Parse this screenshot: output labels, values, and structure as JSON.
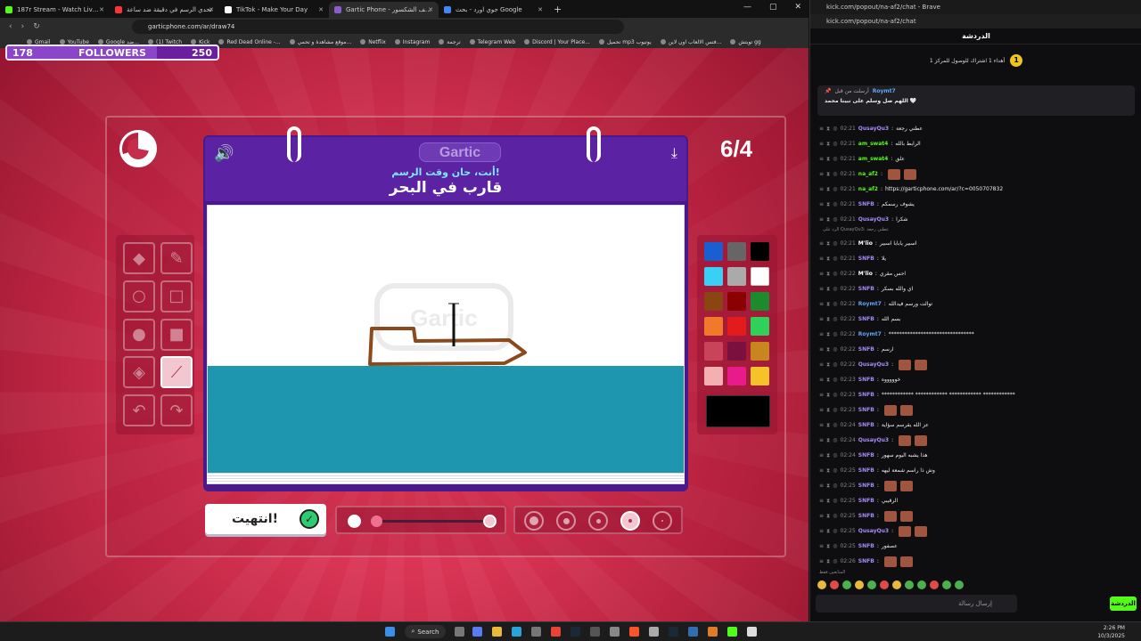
{
  "tabs": [
    {
      "title": "187r Stream - Watch Live on Kick",
      "color": "#53fc18"
    },
    {
      "title": "تحدي الرسم في دقيقة ضد ساعة",
      "color": "#ff3333"
    },
    {
      "title": "TikTok - Make Your Day",
      "color": "#ffffff"
    },
    {
      "title": "Gartic Phone - لعبة الهاتف الشكسور",
      "color": "#8a5ccc",
      "active": true
    },
    {
      "title": "جوي اورد - بحث Google",
      "color": "#4285f4"
    }
  ],
  "address_url": "garticphone.com/ar/draw74",
  "bookmarks": [
    "Gmail",
    "YouTube",
    "Google ضد...",
    "(1) Twitch",
    "Kick",
    "Red Dead Online -...",
    "موقع مشاهدة و تحمي...",
    "Netflix",
    "Instagram",
    "ترجمة",
    "Telegram Web",
    "Discord | Your Place...",
    "تحميل mp3 يوتيوب",
    "فتس الالعاب اون لاين...",
    "تويتش gg"
  ],
  "followers": {
    "label": "FOLLOWERS",
    "current": "178",
    "goal": "250",
    "progress": 0.712
  },
  "game": {
    "counter": "6/4",
    "logo": "Gartic",
    "subtitle": "أنت، حان وقت الرسم!",
    "prompt": "قارب في البحر",
    "done_label": "انتهيت!",
    "watermark": "Gartic",
    "tools": [
      {
        "name": "eraser-tool",
        "icon": "◆"
      },
      {
        "name": "pencil-tool",
        "icon": "✎"
      },
      {
        "name": "ellipse-outline-tool",
        "icon": "○"
      },
      {
        "name": "rect-outline-tool",
        "icon": "□"
      },
      {
        "name": "ellipse-fill-tool",
        "icon": "●"
      },
      {
        "name": "rect-fill-tool",
        "icon": "■"
      },
      {
        "name": "bucket-tool",
        "icon": "◈"
      },
      {
        "name": "line-tool",
        "icon": "⟋",
        "selected": true
      },
      {
        "name": "undo-tool",
        "icon": "↶"
      },
      {
        "name": "redo-tool",
        "icon": "↷"
      }
    ],
    "palette": [
      "#1a5fd1",
      "#666666",
      "#000000",
      "#3ad0f5",
      "#aaaaaa",
      "#ffffff",
      "#8b4513",
      "#8b0000",
      "#1e8a2e",
      "#f07a2a",
      "#e41b1b",
      "#2fd158",
      "#c9445a",
      "#7a1040",
      "#c8861e",
      "#f4b0b0",
      "#e81a8c",
      "#f5c22a"
    ],
    "current_color": "#000000",
    "brush_sizes": 5,
    "selected_size": 4
  },
  "chat": {
    "window_title": "kick.com/popout/na-af2/chat - Brave",
    "url": "kick.com/popout/na-af2/chat",
    "header": "الدردشة",
    "subgoal": "أهداء 1 اشتراك للوصول للمركز 1",
    "subgoal_badge": "1",
    "pinned_by": "أرسلت من قبل",
    "pinned_user": "Roymt7",
    "pinned_text": "اللهم صل وسلم على نبينا محمد 🤍",
    "messages": [
      {
        "time": "02:21",
        "user": "QusayQu3",
        "color": "#a78bfa",
        "text": "عطني رجعة"
      },
      {
        "time": "02:21",
        "user": "am_swat4",
        "color": "#53fc18",
        "text": "الرابط بالله"
      },
      {
        "time": "02:21",
        "user": "am_swat4",
        "color": "#53fc18",
        "text": "علق"
      },
      {
        "time": "02:21",
        "user": "na_af2",
        "color": "#53fc18",
        "text": ""
      },
      {
        "time": "02:21",
        "user": "na_af2",
        "color": "#53fc18",
        "text": "https://garticphone.com/ar/?c=0050707832"
      },
      {
        "time": "02:21",
        "user": "SNFB",
        "color": "#a78bfa",
        "text": "يشوف رسمكم"
      },
      {
        "time": "02:21",
        "user": "QusayQu3",
        "color": "#a78bfa",
        "text": "شكرا"
      },
      {
        "time": "02:21",
        "user": "M'lio",
        "color": "#ffffff",
        "text": "اسبير يابابا اسبير"
      },
      {
        "time": "02:21",
        "user": "SNFB",
        "color": "#a78bfa",
        "text": "يلا"
      },
      {
        "time": "02:22",
        "user": "M'lio",
        "color": "#ffffff",
        "text": "احس مقري"
      },
      {
        "time": "02:22",
        "user": "SNFB",
        "color": "#a78bfa",
        "text": "اي والله بسكر"
      },
      {
        "time": "02:22",
        "user": "Roymt7",
        "color": "#60a5fa",
        "text": "توالت ورسم فيدالله"
      },
      {
        "time": "02:22",
        "user": "SNFB",
        "color": "#a78bfa",
        "text": "بسم الله"
      },
      {
        "time": "02:22",
        "user": "Roymt7",
        "color": "#60a5fa",
        "text": "********************************"
      },
      {
        "time": "02:22",
        "user": "SNFB",
        "color": "#a78bfa",
        "text": "ارسم"
      },
      {
        "time": "02:22",
        "user": "QusayQu3",
        "color": "#a78bfa",
        "text": ""
      },
      {
        "time": "02:23",
        "user": "SNFB",
        "color": "#a78bfa",
        "text": "خوووووه"
      },
      {
        "time": "02:23",
        "user": "SNFB",
        "color": "#a78bfa",
        "text": "************ ************ ************ ************"
      },
      {
        "time": "02:23",
        "user": "SNFB",
        "color": "#a78bfa",
        "text": ""
      },
      {
        "time": "02:24",
        "user": "SNFB",
        "color": "#a78bfa",
        "text": "عز الله يقرسم سؤاية"
      },
      {
        "time": "02:24",
        "user": "QusayQu3",
        "color": "#a78bfa",
        "text": ""
      },
      {
        "time": "02:24",
        "user": "SNFB",
        "color": "#a78bfa",
        "text": "هذا يشبه اليوم سهور"
      },
      {
        "time": "02:25",
        "user": "SNFB",
        "color": "#a78bfa",
        "text": "وش ذا راسم شمعة ليهه"
      },
      {
        "time": "02:25",
        "user": "SNFB",
        "color": "#a78bfa",
        "text": ""
      },
      {
        "time": "02:25",
        "user": "SNFB",
        "color": "#a78bfa",
        "text": "الرقيبي"
      },
      {
        "time": "02:25",
        "user": "SNFB",
        "color": "#a78bfa",
        "text": ""
      },
      {
        "time": "02:25",
        "user": "QusayQu3",
        "color": "#a78bfa",
        "text": ""
      },
      {
        "time": "02:25",
        "user": "SNFB",
        "color": "#a78bfa",
        "text": "عصفور"
      },
      {
        "time": "02:26",
        "user": "SNFB",
        "color": "#a78bfa",
        "text": ""
      }
    ],
    "reply_note": "الرد على QusayQu3: عطني رجعة",
    "input_placeholder": "إرسال رسالة",
    "send_label": "الدردشة",
    "mods_note": "المتابعين فقط"
  },
  "taskbar": {
    "search": "Search",
    "time": "2:26 PM",
    "date": "10/3/2025"
  }
}
